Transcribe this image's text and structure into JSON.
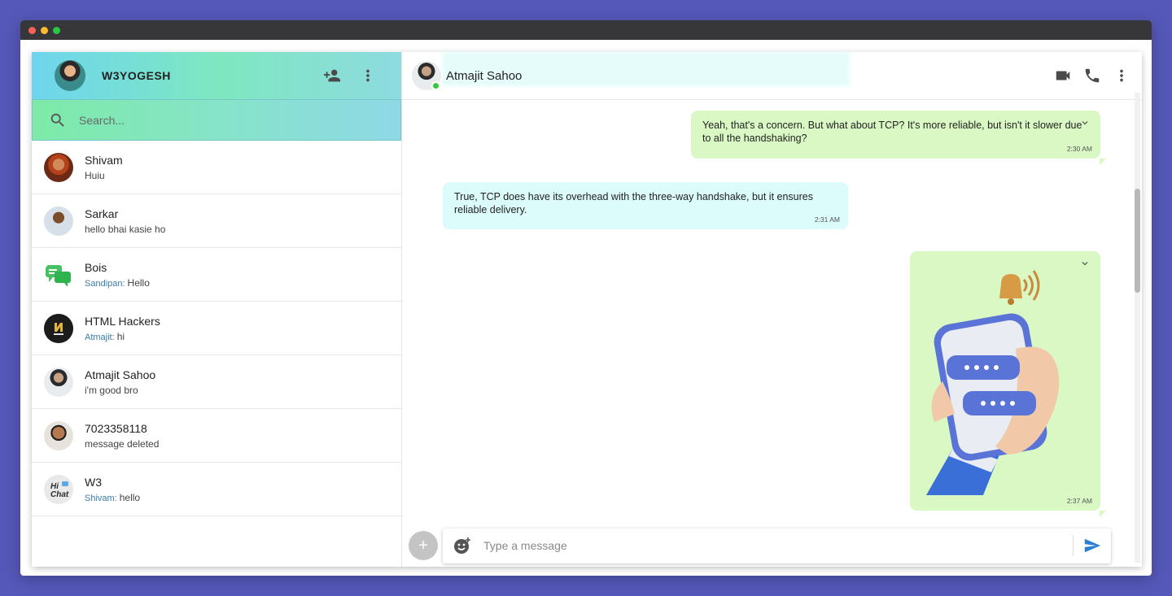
{
  "colors": {
    "page_bg": "#5558b8",
    "sent_bubble": "#d9f8c4",
    "received_bubble": "#dcfbfb",
    "online": "#2ecc40",
    "send_icon": "#2a7fd4"
  },
  "me": {
    "name": "W3YOGESH"
  },
  "search": {
    "placeholder": "Search..."
  },
  "chats": [
    {
      "name": "Shivam",
      "sender": "",
      "last": "Huiu"
    },
    {
      "name": "Sarkar",
      "sender": "",
      "last": "hello bhai kasie ho"
    },
    {
      "name": "Bois",
      "sender": "Sandipan:",
      "last": "Hello"
    },
    {
      "name": "HTML Hackers",
      "sender": "Atmajit:",
      "last": "hi"
    },
    {
      "name": "Atmajit Sahoo",
      "sender": "",
      "last": "i'm good bro"
    },
    {
      "name": "7023358118",
      "sender": "",
      "last": "message deleted"
    },
    {
      "name": "W3",
      "sender": "Shivam:",
      "last": "hello"
    }
  ],
  "conversation": {
    "contact": "Atmajit Sahoo",
    "messages": [
      {
        "type": "sent",
        "text": "Yeah, that's a concern. But what about TCP? It's more reliable, but isn't it slower due to all the handshaking?",
        "time": "2:30 AM"
      },
      {
        "type": "received",
        "text": "True, TCP does have its overhead with the three-way handshake, but it ensures reliable delivery.",
        "time": "2:31 AM"
      },
      {
        "type": "sent-image",
        "text": "",
        "time": "2:37 AM"
      }
    ]
  },
  "composer": {
    "placeholder": "Type a message",
    "plus": "+"
  }
}
